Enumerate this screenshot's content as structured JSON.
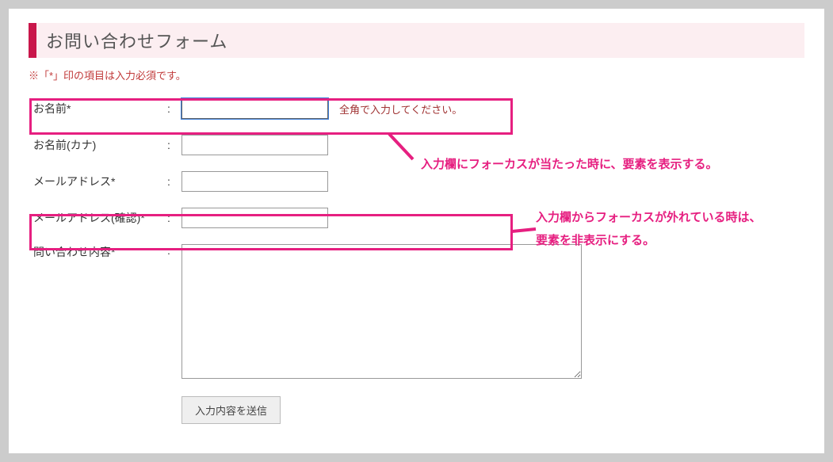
{
  "header": {
    "title": "お問い合わせフォーム"
  },
  "requiredNote": "※「*」印の項目は入力必須です。",
  "fields": {
    "name": {
      "label": "お名前*",
      "value": "",
      "hint": "全角で入力してください。"
    },
    "nameKana": {
      "label": "お名前(カナ)",
      "value": ""
    },
    "email": {
      "label": "メールアドレス*",
      "value": ""
    },
    "emailConfirm": {
      "label": "メールアドレス(確認)*",
      "value": ""
    },
    "inquiry": {
      "label": "問い合わせ内容*",
      "value": ""
    }
  },
  "submit": {
    "label": "入力内容を送信"
  },
  "annotations": {
    "focus": "入力欄にフォーカスが当たった時に、要素を表示する。",
    "blur": "入力欄からフォーカスが外れている時は、\n要素を非表示にする。"
  },
  "colon": ":"
}
